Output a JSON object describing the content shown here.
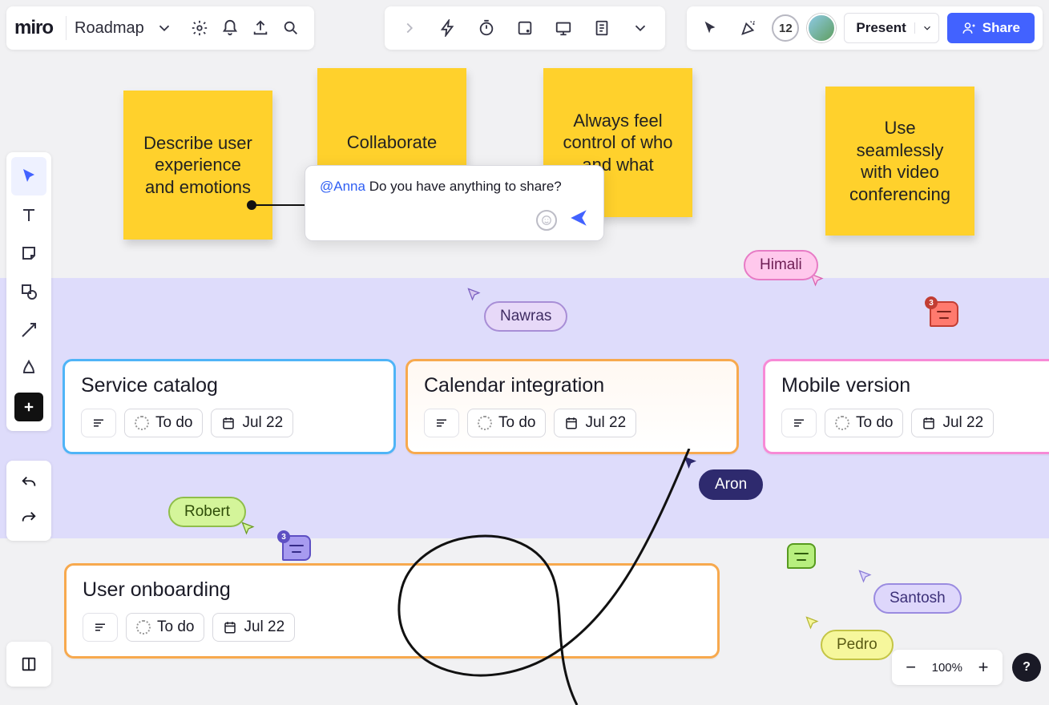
{
  "app": {
    "logo": "miro",
    "board_name": "Roadmap"
  },
  "topbar_right": {
    "user_count": "12",
    "present_label": "Present",
    "share_label": "Share"
  },
  "zoom": {
    "level": "100%"
  },
  "help": {
    "label": "?"
  },
  "stickies": [
    {
      "text": "Describe user experience and emotions"
    },
    {
      "text": "Collaborate"
    },
    {
      "text": "Always feel control of who and what"
    },
    {
      "text": "Use seamlessly with video conferencing"
    }
  ],
  "comment_popup": {
    "mention": "@Anna",
    "text": " Do you have anything to share?"
  },
  "cards": [
    {
      "title": "Service catalog",
      "status": "To do",
      "date": "Jul 22"
    },
    {
      "title": "Calendar integration",
      "status": "To do",
      "date": "Jul 22"
    },
    {
      "title": "Mobile version",
      "status": "To do",
      "date": "Jul 22"
    },
    {
      "title": "User onboarding",
      "status": "To do",
      "date": "Jul 22"
    }
  ],
  "cursors": {
    "nawras": "Nawras",
    "himali": "Himali",
    "aron": "Aron",
    "robert": "Robert",
    "santosh": "Santosh",
    "pedro": "Pedro"
  },
  "speech_badges": {
    "red": "3",
    "purple": "3"
  }
}
